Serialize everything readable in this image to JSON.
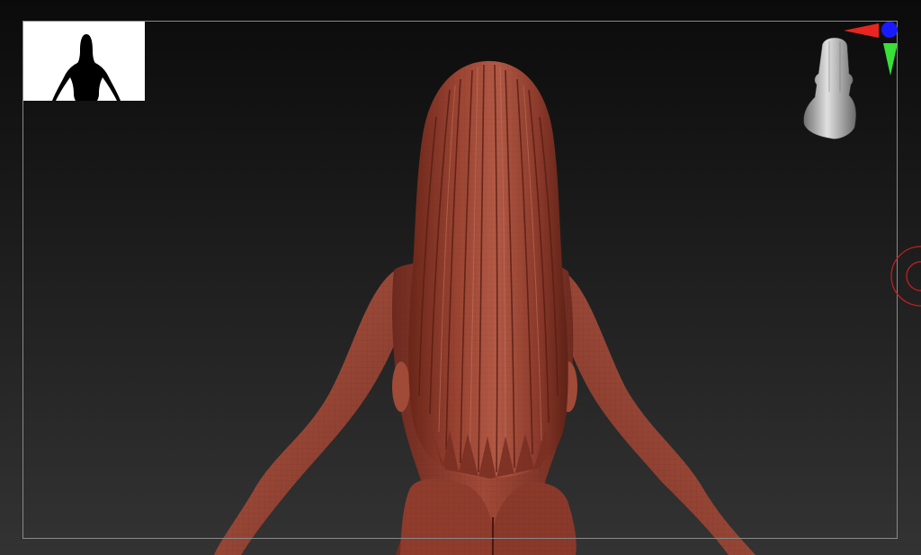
{
  "app": {
    "type": "3d-sculpt-viewport"
  },
  "viewport": {
    "background_top": "#0b0b0b",
    "background_bottom": "#333333",
    "frame_color": "#8a8a8a"
  },
  "thumbnail": {
    "icon": "figure-silhouette-icon",
    "background": "#ffffff",
    "fill": "#000000"
  },
  "model": {
    "icon": "sculpted-figure-back-view",
    "skin_color": "#9e4433",
    "hair_color": "#8c3a2c",
    "highlight_color": "#c76a55"
  },
  "navigator": {
    "icon": "head-orientation-icon",
    "x_axis_color": "#e8261f",
    "y_axis_color": "#38e038",
    "z_axis_color": "#1a1aff"
  },
  "cursor": {
    "icon": "brush-cursor-icon",
    "color": "#cc1f1f"
  }
}
